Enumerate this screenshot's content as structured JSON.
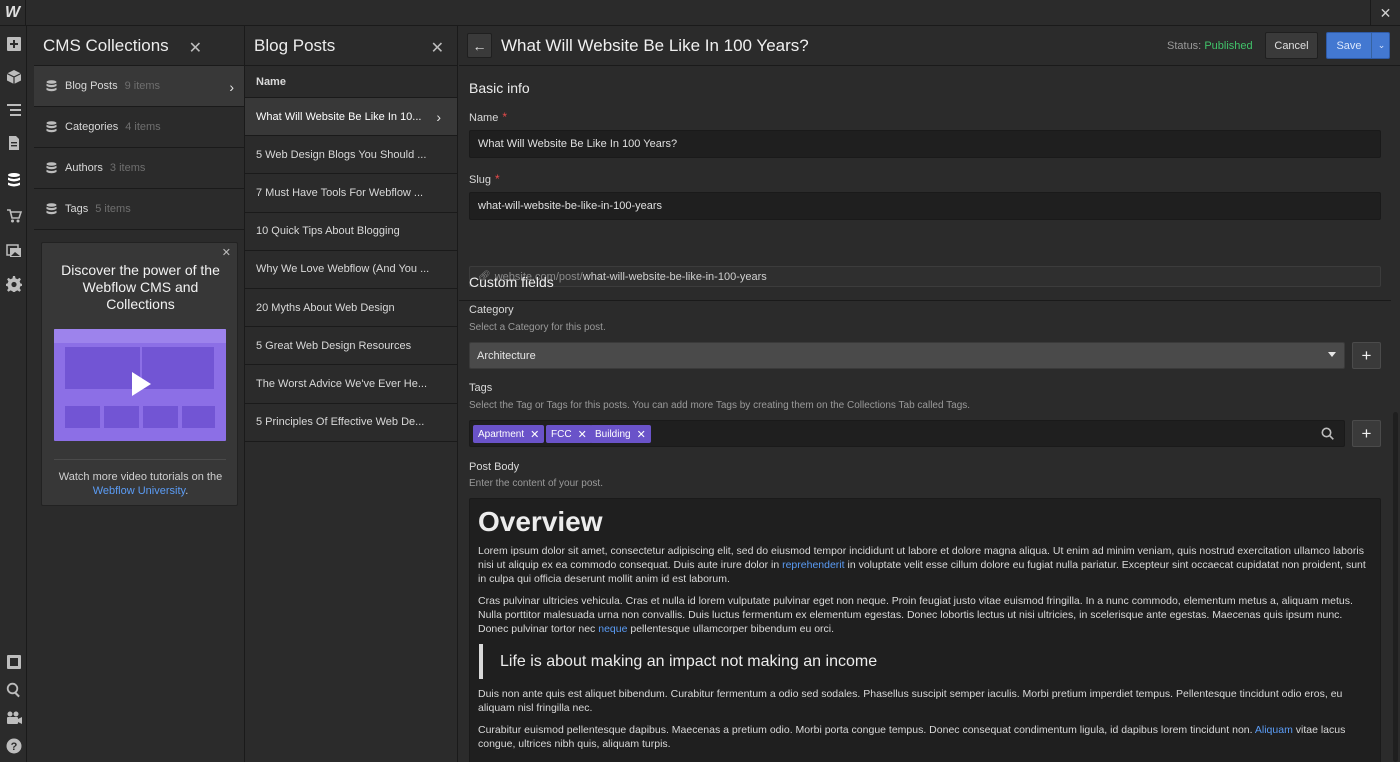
{
  "app": {
    "logo_text": "W"
  },
  "rail": {
    "icons": [
      "add-panel-icon",
      "components-icon",
      "navigator-icon",
      "pages-icon",
      "cms-icon",
      "ecommerce-icon",
      "assets-icon",
      "settings-icon",
      "preview-frame-icon",
      "search-icon",
      "video-tutorials-icon",
      "help-icon"
    ]
  },
  "collections": {
    "title": "CMS Collections",
    "items": [
      {
        "label": "Blog Posts",
        "count": "9 items"
      },
      {
        "label": "Categories",
        "count": "4 items"
      },
      {
        "label": "Authors",
        "count": "3 items"
      },
      {
        "label": "Tags",
        "count": "5 items"
      }
    ],
    "promo": {
      "title": "Discover the power of the Webflow CMS and Collections",
      "footer_text": "Watch more video tutorials on the",
      "footer_link": "Webflow University",
      "footer_end": "."
    }
  },
  "posts": {
    "title": "Blog Posts",
    "column_header": "Name",
    "rows": [
      "What Will Website Be Like In 10...",
      "5 Web Design Blogs You Should ...",
      "7 Must Have Tools For Webflow ...",
      "10 Quick Tips About Blogging",
      "Why We Love Webflow (And You ...",
      "20 Myths About Web Design",
      "5 Great Web Design Resources",
      "The Worst Advice We've Ever He...",
      "5 Principles Of Effective Web De..."
    ]
  },
  "editor": {
    "title": "What Will Website Be Like In 100 Years?",
    "status_label": "Status:",
    "status_value": "Published",
    "cancel_label": "Cancel",
    "save_label": "Save",
    "basic_info": {
      "section_title": "Basic info",
      "name_label": "Name",
      "name_value": "What Will Website Be Like In 100 Years?",
      "slug_label": "Slug",
      "slug_value": "what-will-website-be-like-in-100-years",
      "slug_prefix": "website.com/post/",
      "slug_preview": "what-will-website-be-like-in-100-years",
      "required_mark": "*"
    },
    "custom_fields": {
      "section_title": "Custom fields",
      "category_label": "Category",
      "category_hint": "Select a Category for this post.",
      "category_value": "Architecture",
      "tags_label": "Tags",
      "tags_hint": "Select the Tag or Tags for this posts. You can add more Tags by creating them on the Collections Tab called Tags.",
      "tags": [
        "Apartment",
        "FCC",
        "Building"
      ],
      "add_symbol": "+",
      "remove_symbol": "✕",
      "body_label": "Post Body",
      "body_hint": "Enter the content of your post."
    },
    "body": {
      "heading": "Overview",
      "p1_a": "Lorem ipsum dolor sit amet, consectetur adipiscing elit, sed do eiusmod tempor incididunt ut labore et dolore magna aliqua. Ut enim ad minim veniam, quis nostrud exercitation ullamco laboris nisi ut aliquip ex ea commodo consequat. Duis aute irure dolor in ",
      "p1_link": "reprehenderit",
      "p1_b": " in voluptate velit esse cillum dolore eu fugiat nulla pariatur. Excepteur sint occaecat cupidatat non proident, sunt in culpa qui officia deserunt mollit anim id est laborum.",
      "p2_a": "Cras pulvinar ultricies vehicula. Cras et nulla id lorem vulputate pulvinar eget non neque. Proin feugiat justo vitae euismod fringilla. In a nunc commodo, elementum metus a, aliquam metus. Nulla porttitor malesuada urna non convallis. Duis luctus fermentum ex elementum egestas. Donec lobortis lectus ut nisi ultricies, in scelerisque ante egestas. Maecenas quis ipsum nunc. Donec pulvinar tortor nec ",
      "p2_link": "neque",
      "p2_b": " pellentesque ullamcorper bibendum eu orci.",
      "quote": "Life is about making an impact not making an income",
      "p3": "Duis non ante quis est aliquet bibendum. Curabitur fermentum a odio sed sodales. Phasellus suscipit semper iaculis. Morbi pretium imperdiet tempus. Pellentesque tincidunt odio eros, eu aliquam nisl fringilla nec.",
      "p4_a": "Curabitur euismod pellentesque dapibus. Maecenas a pretium odio. Morbi porta congue tempus. Donec consequat condimentum ligula, id dapibus lorem tincidunt non. ",
      "p4_link": "Aliquam",
      "p4_b": " vitae lacus congue, ultrices nibh quis, aliquam turpis."
    }
  },
  "colors": {
    "status_published": "#41c26a",
    "save_button": "#4378d1",
    "tag_background": "#6a53c9",
    "link": "#5b9cf5",
    "required": "#e54a4a"
  }
}
